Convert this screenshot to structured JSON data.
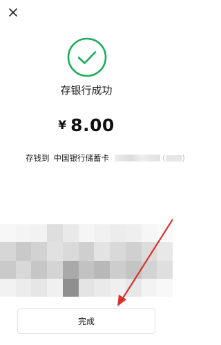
{
  "header": {
    "close_icon": "close-icon"
  },
  "result": {
    "icon": "check-circle-icon",
    "accent_color": "#1aad5a",
    "title": "存银行成功",
    "currency": "¥",
    "amount": "8.00",
    "detail_label": "存钱到",
    "bank_name": "中国银行储蓄卡",
    "card_suffix": "(",
    "card_suffix_close": ")"
  },
  "footer": {
    "done_label": "完成"
  },
  "annotation": {
    "arrow_color": "#d9302c"
  }
}
